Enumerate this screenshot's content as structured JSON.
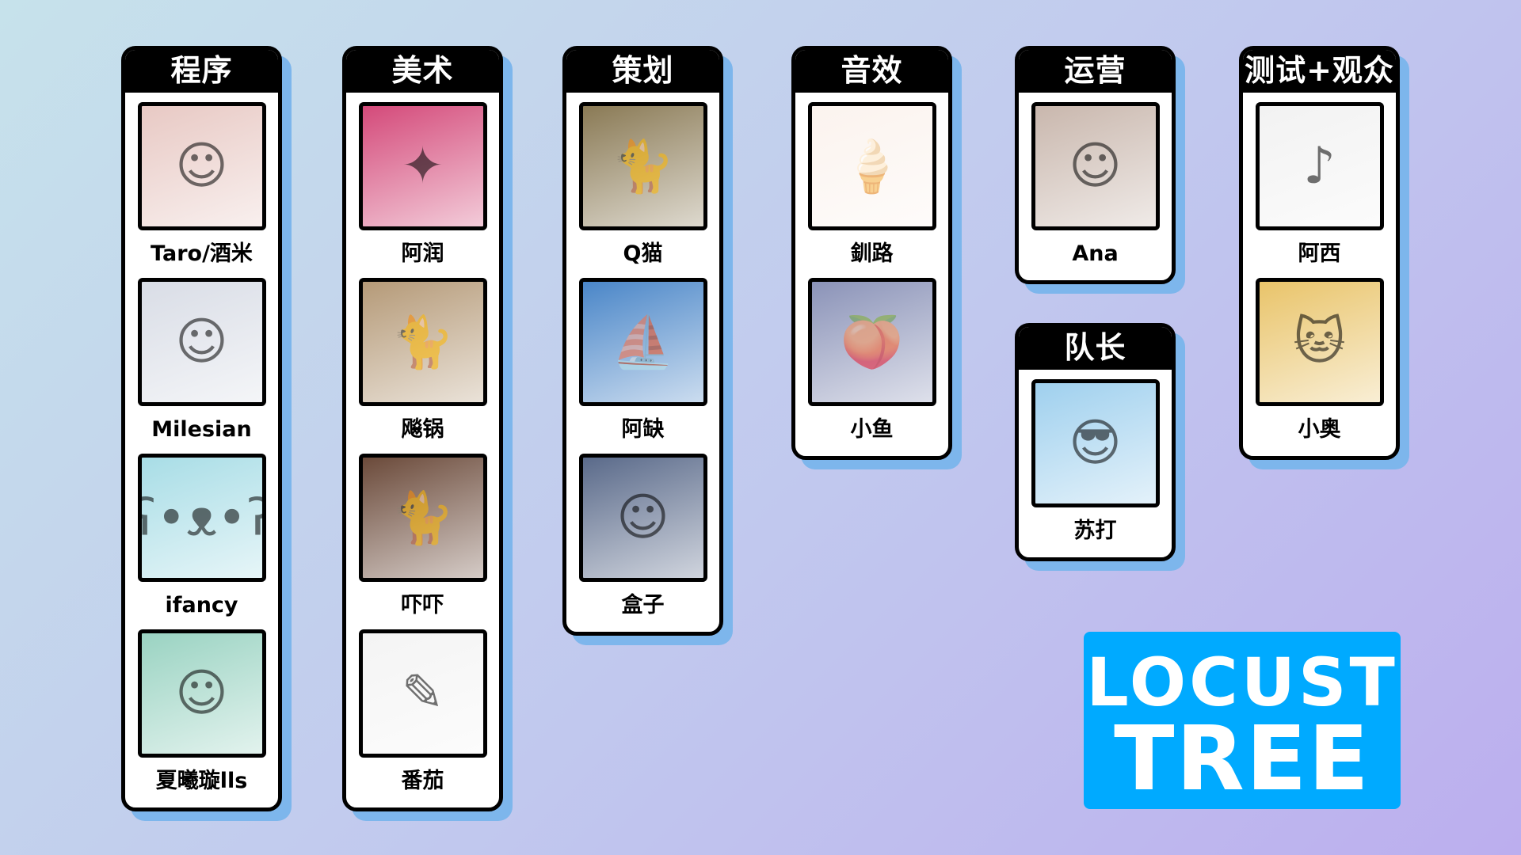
{
  "teams": [
    {
      "title": "程序",
      "members": [
        {
          "name": "Taro/酒米",
          "color": "#e8c9c4",
          "icon": "person-photo"
        },
        {
          "name": "Milesian",
          "color": "#d9dde6",
          "icon": "person-photo"
        },
        {
          "name": "ifancy",
          "color": "#a8dde6",
          "icon": "cartoon-bear"
        },
        {
          "name": "夏曦璇lls",
          "color": "#9ad3c2",
          "icon": "anime-character"
        }
      ]
    },
    {
      "title": "美术",
      "members": [
        {
          "name": "阿润",
          "color": "#d44a7a",
          "icon": "illustration-monster"
        },
        {
          "name": "飚锅",
          "color": "#b59a78",
          "icon": "cat-photo"
        },
        {
          "name": "吓吓",
          "color": "#6b4a3a",
          "icon": "cat-photo"
        },
        {
          "name": "番茄",
          "color": "#f4f4f4",
          "icon": "sketch-character"
        }
      ]
    },
    {
      "title": "策划",
      "members": [
        {
          "name": "Q猫",
          "color": "#8a7a55",
          "icon": "kitten-painting"
        },
        {
          "name": "阿缺",
          "color": "#4a86c8",
          "icon": "ship-painting"
        },
        {
          "name": "盒子",
          "color": "#5a6a8a",
          "icon": "anime-girl"
        }
      ]
    },
    {
      "title": "音效",
      "members": [
        {
          "name": "釧路",
          "color": "#fbf3ee",
          "icon": "hello-kitty"
        },
        {
          "name": "小鱼",
          "color": "#8b93b8",
          "icon": "peach-sunglasses"
        }
      ]
    },
    {
      "title": "运营",
      "members": [
        {
          "name": "Ana",
          "color": "#c9b7ad",
          "icon": "person-photo"
        }
      ]
    },
    {
      "title": "队长",
      "members": [
        {
          "name": "苏打",
          "color": "#9fd0ee",
          "icon": "cartoon-sunglasses-man"
        }
      ]
    },
    {
      "title": "测试+观众",
      "members": [
        {
          "name": "阿西",
          "color": "#f2f2f2",
          "icon": "sketch-singer"
        },
        {
          "name": "小奥",
          "color": "#e9c46a",
          "icon": "cartoon-cat"
        }
      ]
    }
  ],
  "logo": {
    "line1": "LOCUST",
    "line2": "TREE",
    "color": "#00aaff"
  },
  "colors": {
    "card_shadow": "#7db6ec",
    "header": "#000000"
  }
}
